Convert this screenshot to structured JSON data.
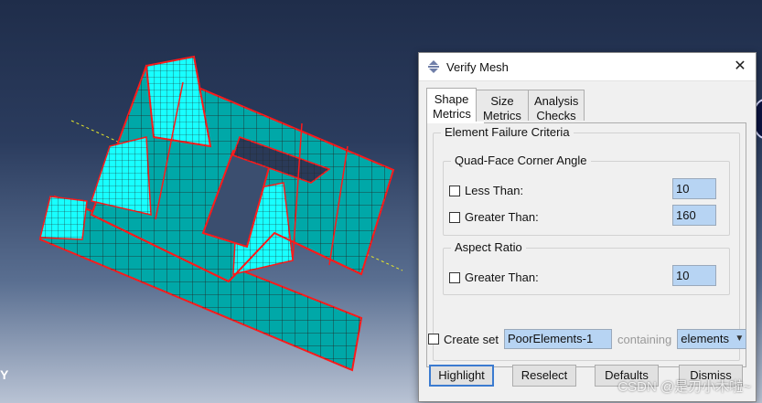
{
  "dialog": {
    "title": "Verify Mesh",
    "close_glyph": "✕",
    "tabs": [
      {
        "line1": "Shape",
        "line2": "Metrics",
        "active": true
      },
      {
        "line1": "Size",
        "line2": "Metrics",
        "active": false
      },
      {
        "line1": "Analysis",
        "line2": "Checks",
        "active": false
      }
    ],
    "criteria_group_label": "Element Failure Criteria",
    "quad_group_label": "Quad-Face Corner Angle",
    "quad_less_label": "Less Than:",
    "quad_less_value": "10",
    "quad_less_checked": false,
    "quad_greater_label": "Greater Than:",
    "quad_greater_value": "160",
    "quad_greater_checked": false,
    "aspect_group_label": "Aspect Ratio",
    "aspect_greater_label": "Greater Than:",
    "aspect_greater_value": "10",
    "aspect_greater_checked": false,
    "create_set_label": "Create set",
    "create_set_checked": false,
    "set_name": "PoorElements-1",
    "containing_label": "containing",
    "containing_value": "elements",
    "buttons": {
      "highlight": "Highlight",
      "reselect": "Reselect",
      "defaults": "Defaults",
      "dismiss": "Dismiss"
    }
  },
  "viewport": {
    "axis_label": "Y",
    "mesh_fill_color": "#00a8a8",
    "mesh_highlight_color": "#18ffff",
    "mesh_edge_color": "#ff1a1a"
  },
  "watermark": "CSDN @是刃小木啦~"
}
